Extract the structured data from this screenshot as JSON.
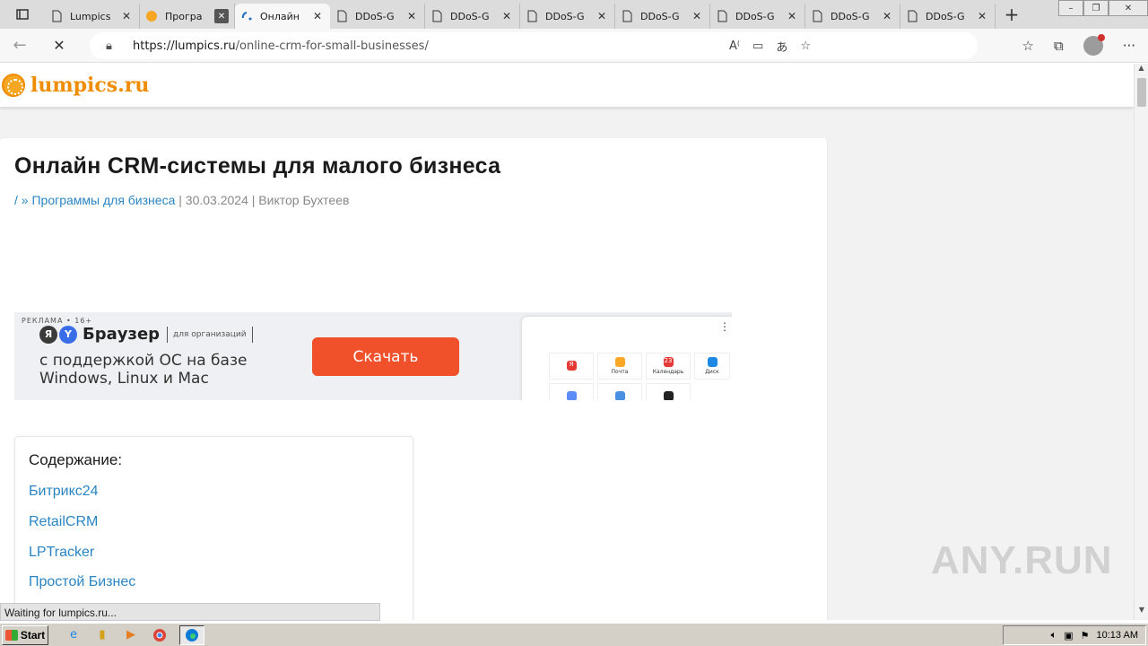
{
  "browser": {
    "tabs": [
      {
        "title": "Lumpics",
        "icon": "page-icon",
        "close": "close-icon"
      },
      {
        "title": "Програ",
        "icon": "orange-favicon-icon",
        "close": "close-icon"
      },
      {
        "title": "Онлайн",
        "icon": "loading-icon",
        "close": "close-icon",
        "active": true
      },
      {
        "title": "DDoS-G",
        "icon": "page-icon",
        "close": "close-icon"
      },
      {
        "title": "DDoS-G",
        "icon": "page-icon",
        "close": "close-icon"
      },
      {
        "title": "DDoS-G",
        "icon": "page-icon",
        "close": "close-icon"
      },
      {
        "title": "DDoS-G",
        "icon": "page-icon",
        "close": "close-icon"
      },
      {
        "title": "DDoS-G",
        "icon": "page-icon",
        "close": "close-icon"
      },
      {
        "title": "DDoS-G",
        "icon": "page-icon",
        "close": "close-icon"
      },
      {
        "title": "DDoS-G",
        "icon": "page-icon",
        "close": "close-icon"
      }
    ],
    "url_host": "https://lumpics.ru",
    "url_path": "/online-crm-for-small-businesses/",
    "status_text": "Waiting for lumpics.ru..."
  },
  "site": {
    "logo_text": "lumpics.ru"
  },
  "article": {
    "title": "Онлайн CRM-системы для малого бизнеса",
    "breadcrumb_home": "/",
    "breadcrumb_sep": " » ",
    "category": "Программы для бизнеса",
    "meta_sep1": " | ",
    "date": "30.03.2024",
    "meta_sep2": " | ",
    "author": "Виктор Бухтеев"
  },
  "ad": {
    "label": "РЕКЛАМА • 16+",
    "brand": "Браузер",
    "org_label": "для организаций",
    "text": "с поддержкой ОС на базе Windows, Linux и Mac",
    "cta": "Скачать",
    "tiles": [
      "Я",
      "Почта",
      "Календарь",
      "Диск"
    ],
    "calendar_num": "23"
  },
  "toc": {
    "heading": "Содержание:",
    "items": [
      "Битрикс24",
      "RetailCRM",
      "LPTracker",
      "Простой Бизнес"
    ]
  },
  "watermark": "ANY.RUN",
  "taskbar": {
    "start_label": "Start",
    "clock": "10:13 AM"
  }
}
